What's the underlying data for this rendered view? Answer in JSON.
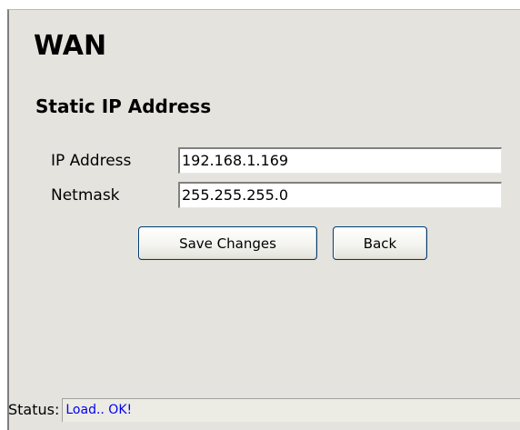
{
  "page": {
    "title": "WAN",
    "section_title": "Static IP Address"
  },
  "form": {
    "ip_address": {
      "label": "IP Address",
      "value": "192.168.1.169"
    },
    "netmask": {
      "label": "Netmask",
      "value": "255.255.255.0"
    }
  },
  "buttons": {
    "save_label": "Save Changes",
    "back_label": "Back"
  },
  "status": {
    "label": "Status:",
    "value": "Load.. OK!",
    "value_color": "#0000ee"
  },
  "colors": {
    "panel_background": "#e4e3de",
    "button_border": "#003c74"
  }
}
